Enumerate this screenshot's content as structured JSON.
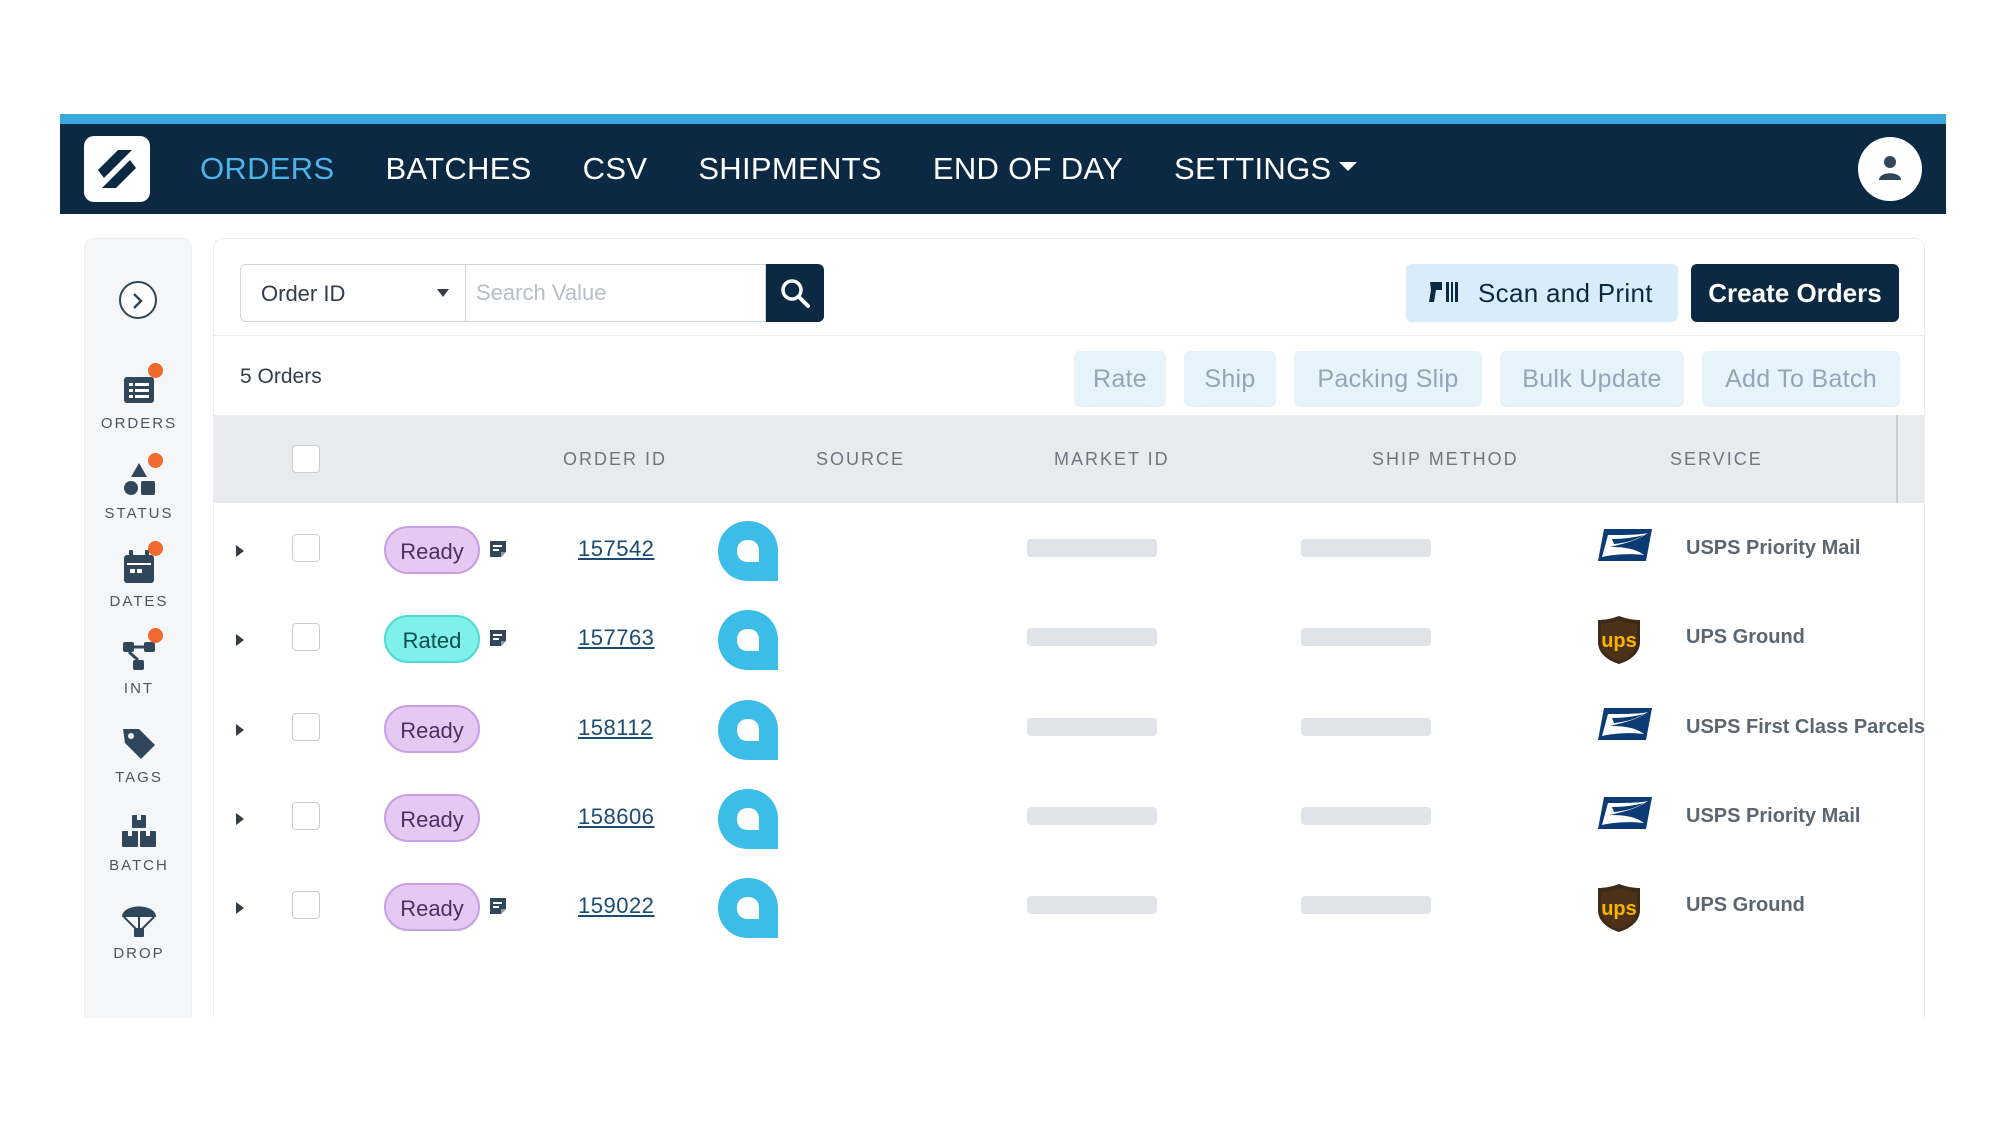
{
  "nav": {
    "items": [
      {
        "label": "ORDERS",
        "active": true
      },
      {
        "label": "BATCHES",
        "active": false
      },
      {
        "label": "CSV",
        "active": false
      },
      {
        "label": "SHIPMENTS",
        "active": false
      },
      {
        "label": "END OF DAY",
        "active": false
      },
      {
        "label": "SETTINGS",
        "active": false
      }
    ],
    "logo_icon": "shipping-logo-icon",
    "avatar_icon": "user-icon"
  },
  "sidebar": {
    "expand_icon": "chevron-right-icon",
    "items": [
      {
        "label": "ORDERS",
        "icon": "orders-list-icon",
        "badge": true
      },
      {
        "label": "STATUS",
        "icon": "status-shapes-icon",
        "badge": true
      },
      {
        "label": "DATES",
        "icon": "calendar-icon",
        "badge": true
      },
      {
        "label": "INT",
        "icon": "integration-icon",
        "badge": true
      },
      {
        "label": "TAGS",
        "icon": "tag-icon",
        "badge": false
      },
      {
        "label": "BATCH",
        "icon": "boxes-icon",
        "badge": false
      },
      {
        "label": "DROP",
        "icon": "parachute-icon",
        "badge": false
      }
    ]
  },
  "toolbar": {
    "search_field_selected": "Order ID",
    "search_placeholder": "Search Value",
    "search_icon": "search-icon",
    "scan_label": "Scan and Print",
    "scan_icon": "barcode-scanner-icon",
    "create_label": "Create Orders"
  },
  "summary": {
    "count_text": "5 Orders",
    "actions": [
      "Rate",
      "Ship",
      "Packing Slip",
      "Bulk Update",
      "Add To Batch"
    ]
  },
  "table": {
    "headers": [
      "ORDER ID",
      "SOURCE",
      "MARKET ID",
      "SHIP METHOD",
      "SERVICE"
    ],
    "rows": [
      {
        "status": "Ready",
        "status_type": "ready",
        "has_note": true,
        "order_id": "157542",
        "carrier": "usps",
        "service": "USPS Priority Mail"
      },
      {
        "status": "Rated",
        "status_type": "rated",
        "has_note": true,
        "order_id": "157763",
        "carrier": "ups",
        "service": "UPS Ground"
      },
      {
        "status": "Ready",
        "status_type": "ready",
        "has_note": false,
        "order_id": "158112",
        "carrier": "usps",
        "service": "USPS First Class Parcels"
      },
      {
        "status": "Ready",
        "status_type": "ready",
        "has_note": false,
        "order_id": "158606",
        "carrier": "usps",
        "service": "USPS Priority Mail"
      },
      {
        "status": "Ready",
        "status_type": "ready",
        "has_note": true,
        "order_id": "159022",
        "carrier": "ups",
        "service": "UPS Ground"
      }
    ]
  },
  "colors": {
    "nav_bg": "#0b2942",
    "nav_accent": "#3ba7dc",
    "active_nav": "#4db3e8",
    "badge": "#ef6a2c",
    "ready_pill": "#e5c9f3",
    "rated_pill": "#7ff0ea",
    "source_icon": "#3cbde8"
  }
}
